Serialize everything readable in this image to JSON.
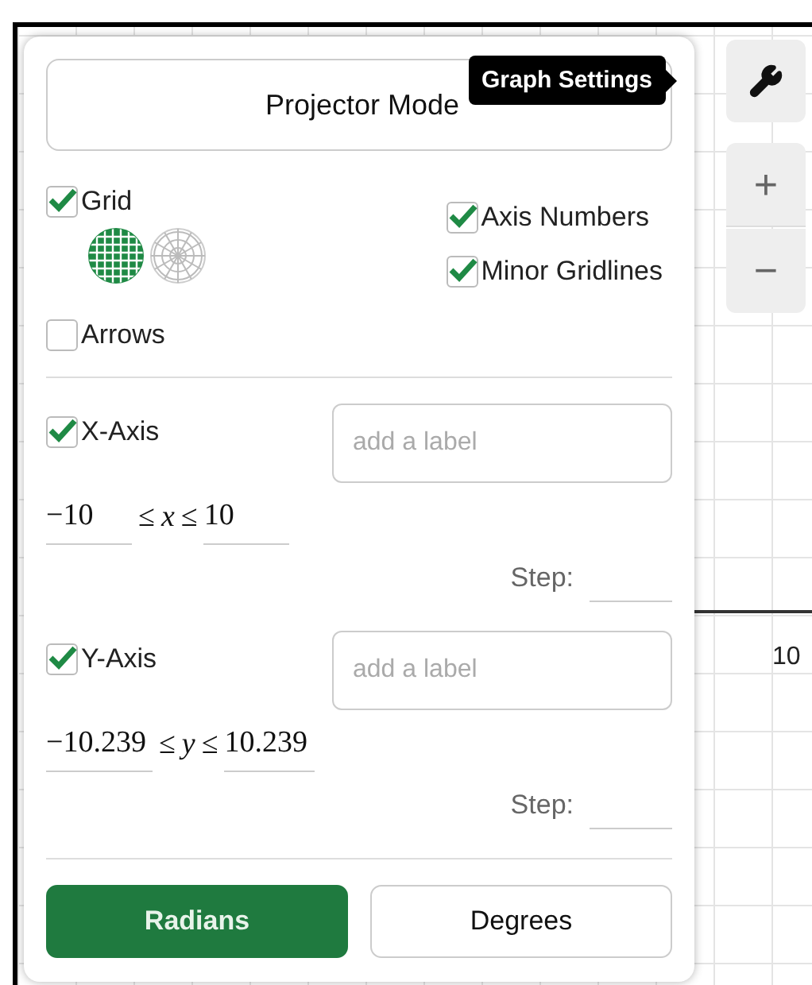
{
  "projector_mode": {
    "label": "Projector Mode"
  },
  "tooltip": {
    "text": "Graph Settings"
  },
  "grid": {
    "label": "Grid",
    "checked": true,
    "styles": [
      {
        "kind": "cartesian",
        "selected": true
      },
      {
        "kind": "polar",
        "selected": false
      }
    ]
  },
  "options": [
    {
      "label": "Axis Numbers",
      "checked": true
    },
    {
      "label": "Minor Gridlines",
      "checked": true
    }
  ],
  "arrows": {
    "label": "Arrows",
    "checked": false
  },
  "axes": [
    {
      "label": "X-Axis",
      "checked": true,
      "placeholder": "add a label",
      "min": "−10",
      "relation": "≤",
      "variable": "x",
      "max": "10",
      "step_label": "Step:"
    },
    {
      "label": "Y-Axis",
      "checked": true,
      "placeholder": "add a label",
      "min": "−10.239",
      "relation": "≤",
      "variable": "y",
      "max": "10.239",
      "step_label": "Step:"
    }
  ],
  "angle_modes": [
    {
      "label": "Radians",
      "selected": true
    },
    {
      "label": "Degrees",
      "selected": false
    }
  ],
  "zoom": {
    "zoom_in": "+",
    "zoom_out": "−"
  },
  "axis_number": "10"
}
